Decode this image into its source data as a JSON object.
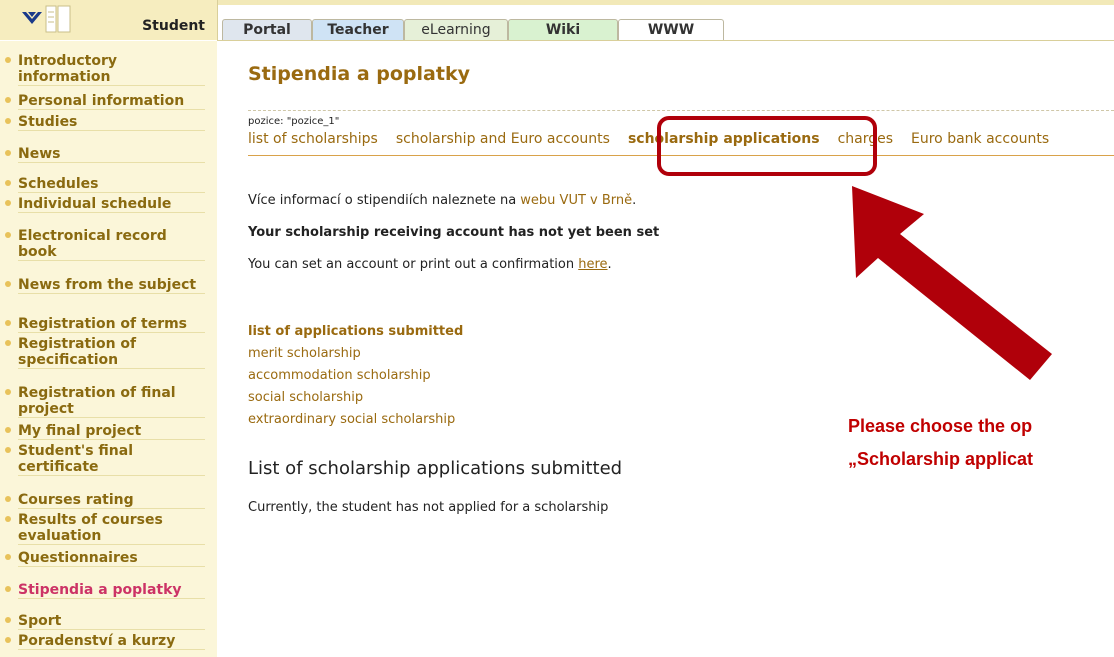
{
  "header": {
    "student_label": "Student",
    "tabs": [
      "Portal",
      "Teacher",
      "eLearning",
      "Wiki",
      "WWW"
    ]
  },
  "sidebar": {
    "items": [
      "Introductory information",
      "Personal information",
      "Studies",
      "News",
      "Schedules",
      "Individual schedule",
      "Electronical record book",
      "News from the subject",
      "Registration of terms",
      "Registration of specification",
      "Registration of final project",
      "My final project",
      "Student's final certificate",
      "Courses rating",
      "Results of courses evaluation",
      "Questionnaires",
      "Stipendia a poplatky",
      "Sport",
      "Poradenství a kurzy"
    ],
    "active": "Stipendia a poplatky"
  },
  "main": {
    "title": "Stipendia a poplatky",
    "pozice": "pozice: \"pozice_1\"",
    "subnav": [
      "list of scholarships",
      "scholarship and Euro accounts",
      "scholarship applications",
      "charges",
      "Euro bank accounts"
    ],
    "subnav_selected": "scholarship applications",
    "info_prefix": "Více informací o stipendiích naleznete na ",
    "info_link": "webu VUT v Brně",
    "info_suffix": ".",
    "account_notice": "Your scholarship receiving account has not yet been set",
    "account_prefix": "You can set an account or print out a confirmation ",
    "account_link": "here",
    "account_suffix": ".",
    "applications": [
      "list of applications submitted",
      "merit scholarship",
      "accommodation scholarship",
      "social scholarship",
      "extraordinary social scholarship"
    ],
    "section_heading": "List of scholarship applications submitted",
    "status_text": "Currently, the student has not applied for a scholarship"
  },
  "annotation": {
    "line1": "Please choose the op",
    "line2": "„Scholarship applicat",
    "color": "#b0000a"
  }
}
